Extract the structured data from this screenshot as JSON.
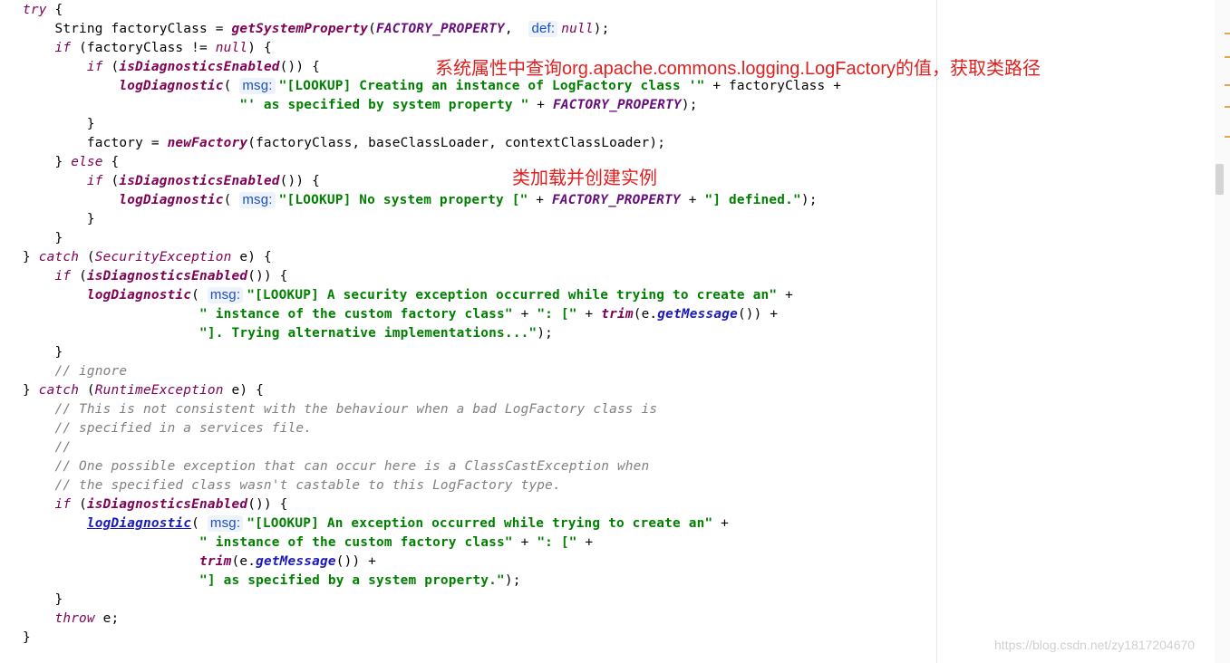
{
  "code_lines": [
    {
      "indent": "",
      "tokens": [
        {
          "t": "try",
          "c": "kwi"
        },
        {
          "t": " {"
        }
      ]
    },
    {
      "indent": "    ",
      "tokens": [
        {
          "t": "String factoryClass = "
        },
        {
          "t": "getSystemProperty",
          "c": "mth"
        },
        {
          "t": "("
        },
        {
          "t": "FACTORY_PROPERTY",
          "c": "cst"
        },
        {
          "t": ",  "
        },
        {
          "h": "def:"
        },
        {
          "t": "null",
          "c": "kwi"
        },
        {
          "t": ");"
        }
      ]
    },
    {
      "indent": "    ",
      "tokens": [
        {
          "t": "if",
          "c": "kwi"
        },
        {
          "t": " (factoryClass != "
        },
        {
          "t": "null",
          "c": "kwi"
        },
        {
          "t": ") {"
        }
      ]
    },
    {
      "indent": "        ",
      "tokens": [
        {
          "t": "if",
          "c": "kwi"
        },
        {
          "t": " ("
        },
        {
          "t": "isDiagnosticsEnabled",
          "c": "mth"
        },
        {
          "t": "()) {"
        }
      ]
    },
    {
      "indent": "            ",
      "tokens": [
        {
          "t": "logDiagnostic",
          "c": "mth"
        },
        {
          "t": "( "
        },
        {
          "h": "msg:"
        },
        {
          "t": "\"[LOOKUP] Creating an instance of LogFactory class '\"",
          "c": "str"
        },
        {
          "t": " + factoryClass +"
        }
      ]
    },
    {
      "indent": "                           ",
      "tokens": [
        {
          "t": "\"' as specified by system property \"",
          "c": "str"
        },
        {
          "t": " + "
        },
        {
          "t": "FACTORY_PROPERTY",
          "c": "cst"
        },
        {
          "t": ");"
        }
      ]
    },
    {
      "indent": "        ",
      "tokens": [
        {
          "t": "}"
        }
      ]
    },
    {
      "indent": "        ",
      "tokens": [
        {
          "t": "factory = "
        },
        {
          "t": "newFactory",
          "c": "mth"
        },
        {
          "t": "(factoryClass, baseClassLoader, contextClassLoader);"
        }
      ]
    },
    {
      "indent": "    ",
      "tokens": [
        {
          "t": "} "
        },
        {
          "t": "else",
          "c": "kwi"
        },
        {
          "t": " {"
        }
      ]
    },
    {
      "indent": "        ",
      "tokens": [
        {
          "t": "if",
          "c": "kwi"
        },
        {
          "t": " ("
        },
        {
          "t": "isDiagnosticsEnabled",
          "c": "mth"
        },
        {
          "t": "()) {"
        }
      ]
    },
    {
      "indent": "            ",
      "tokens": [
        {
          "t": "logDiagnostic",
          "c": "mth"
        },
        {
          "t": "( "
        },
        {
          "h": "msg:"
        },
        {
          "t": "\"[LOOKUP] No system property [\"",
          "c": "str"
        },
        {
          "t": " + "
        },
        {
          "t": "FACTORY_PROPERTY",
          "c": "cst"
        },
        {
          "t": " + "
        },
        {
          "t": "\"] defined.\"",
          "c": "str"
        },
        {
          "t": ");"
        }
      ]
    },
    {
      "indent": "        ",
      "tokens": [
        {
          "t": "}"
        }
      ]
    },
    {
      "indent": "    ",
      "tokens": [
        {
          "t": "}"
        }
      ]
    },
    {
      "indent": "",
      "tokens": [
        {
          "t": "} "
        },
        {
          "t": "catch",
          "c": "kwi"
        },
        {
          "t": " ("
        },
        {
          "t": "SecurityException",
          "c": "kwi"
        },
        {
          "t": " e) {"
        }
      ]
    },
    {
      "indent": "    ",
      "tokens": [
        {
          "t": "if",
          "c": "kwi"
        },
        {
          "t": " ("
        },
        {
          "t": "isDiagnosticsEnabled",
          "c": "mth"
        },
        {
          "t": "()) {"
        }
      ]
    },
    {
      "indent": "        ",
      "tokens": [
        {
          "t": "logDiagnostic",
          "c": "mth"
        },
        {
          "t": "( "
        },
        {
          "h": "msg:"
        },
        {
          "t": "\"[LOOKUP] A security exception occurred while trying to create an\"",
          "c": "str"
        },
        {
          "t": " +"
        }
      ]
    },
    {
      "indent": "                      ",
      "tokens": [
        {
          "t": "\" instance of the custom factory class\"",
          "c": "str"
        },
        {
          "t": " + "
        },
        {
          "t": "\": [\"",
          "c": "str"
        },
        {
          "t": " + "
        },
        {
          "t": "trim",
          "c": "mth"
        },
        {
          "t": "(e."
        },
        {
          "t": "getMessage",
          "c": "mtb"
        },
        {
          "t": "()) +"
        }
      ]
    },
    {
      "indent": "                      ",
      "tokens": [
        {
          "t": "\"]. Trying alternative implementations...\"",
          "c": "str"
        },
        {
          "t": ");"
        }
      ]
    },
    {
      "indent": "    ",
      "tokens": [
        {
          "t": "}"
        }
      ]
    },
    {
      "indent": "    ",
      "tokens": [
        {
          "t": "// ignore",
          "c": "cmt"
        }
      ]
    },
    {
      "indent": "",
      "tokens": [
        {
          "t": "} "
        },
        {
          "t": "catch",
          "c": "kwi"
        },
        {
          "t": " ("
        },
        {
          "t": "RuntimeException",
          "c": "kwi"
        },
        {
          "t": " e) {"
        }
      ]
    },
    {
      "indent": "    ",
      "tokens": [
        {
          "t": "// This is not consistent with the behaviour when a bad LogFactory class is",
          "c": "cmt"
        }
      ]
    },
    {
      "indent": "    ",
      "tokens": [
        {
          "t": "// specified in a services file.",
          "c": "cmt"
        }
      ]
    },
    {
      "indent": "    ",
      "tokens": [
        {
          "t": "//",
          "c": "cmt"
        }
      ]
    },
    {
      "indent": "    ",
      "tokens": [
        {
          "t": "// One possible exception that can occur here is a ClassCastException when",
          "c": "cmt"
        }
      ]
    },
    {
      "indent": "    ",
      "tokens": [
        {
          "t": "// the specified class wasn't castable to this LogFactory type.",
          "c": "cmt"
        }
      ]
    },
    {
      "indent": "    ",
      "tokens": [
        {
          "t": "if",
          "c": "kwi"
        },
        {
          "t": " ("
        },
        {
          "t": "isDiagnosticsEnabled",
          "c": "mth"
        },
        {
          "t": "()) {"
        }
      ]
    },
    {
      "indent": "        ",
      "tokens": [
        {
          "t": "logDiagnostic",
          "c": "lnk"
        },
        {
          "t": "( "
        },
        {
          "h": "msg:"
        },
        {
          "t": "\"[LOOKUP] An exception occurred while trying to create an\"",
          "c": "str"
        },
        {
          "t": " +"
        }
      ]
    },
    {
      "indent": "                      ",
      "tokens": [
        {
          "t": "\" instance of the custom factory class\"",
          "c": "str"
        },
        {
          "t": " + "
        },
        {
          "t": "\": [\"",
          "c": "str"
        },
        {
          "t": " +"
        }
      ]
    },
    {
      "indent": "                      ",
      "tokens": [
        {
          "t": "trim",
          "c": "mth"
        },
        {
          "t": "(e."
        },
        {
          "t": "getMessage",
          "c": "mtb"
        },
        {
          "t": "()) +"
        }
      ]
    },
    {
      "indent": "                      ",
      "tokens": [
        {
          "t": "\"] as specified by a system property.\"",
          "c": "str"
        },
        {
          "t": ");"
        }
      ]
    },
    {
      "indent": "    ",
      "tokens": [
        {
          "t": "}"
        }
      ]
    },
    {
      "indent": "    ",
      "tokens": [
        {
          "t": "throw",
          "c": "kwi"
        },
        {
          "t": " e;"
        }
      ]
    },
    {
      "indent": "",
      "tokens": [
        {
          "t": "}"
        }
      ]
    }
  ],
  "annotations": {
    "system_property_note": "系统属性中查询org.apache.commons.logging.LogFactory的值，获取类路径",
    "class_load_note": "类加载并创建实例"
  },
  "watermark": "https://blog.csdn.net/zy1817204670",
  "colors": {
    "keyword": "#7f0055",
    "string": "#008000",
    "comment": "#808080",
    "constant": "#660e7a",
    "hint": "#1a4fc4",
    "annotation": "#e02020"
  }
}
